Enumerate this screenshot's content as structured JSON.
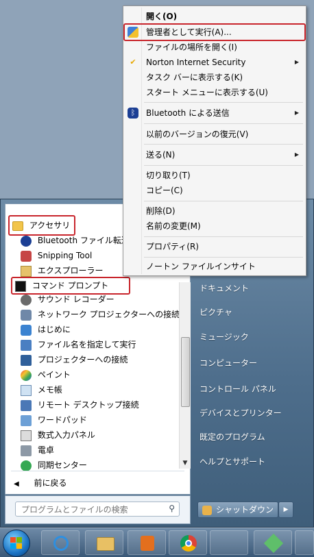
{
  "context_menu": {
    "items": [
      {
        "label": "開く(O)",
        "bold": true
      },
      {
        "label": "管理者として実行(A)..."
      },
      {
        "label": "ファイルの場所を開く(I)"
      },
      {
        "label": "Norton Internet Security",
        "submenu": true
      },
      {
        "label": "タスク バーに表示する(K)"
      },
      {
        "label": "スタート メニューに表示する(U)"
      },
      {
        "label": "Bluetooth による送信",
        "submenu": true
      },
      {
        "label": "以前のバージョンの復元(V)"
      },
      {
        "label": "送る(N)",
        "submenu": true
      },
      {
        "label": "切り取り(T)"
      },
      {
        "label": "コピー(C)"
      },
      {
        "label": "削除(D)"
      },
      {
        "label": "名前の変更(M)"
      },
      {
        "label": "プロパティ(R)"
      },
      {
        "label": "ノートン ファイルインサイト"
      }
    ]
  },
  "left_pane": {
    "folder": "アクセサリ",
    "items": [
      "Bluetooth ファイル転送",
      "Snipping Tool",
      "エクスプローラー",
      "コマンド プロンプト",
      "サウンド レコーダー",
      "ネットワーク プロジェクターへの接続",
      "はじめに",
      "ファイル名を指定して実行",
      "プロジェクターへの接続",
      "ペイント",
      "メモ帳",
      "リモート デスクトップ接続",
      "ワードパッド",
      "数式入力パネル",
      "電卓",
      "同期センター"
    ],
    "back": "前に戻る",
    "search_placeholder": "プログラムとファイルの検索"
  },
  "right_pane": {
    "items": [
      "ドキュメント",
      "ピクチャ",
      "ミュージック",
      "コンピューター",
      "コントロール パネル",
      "デバイスとプリンター",
      "既定のプログラム",
      "ヘルプとサポート"
    ],
    "shutdown": "シャットダウン"
  }
}
